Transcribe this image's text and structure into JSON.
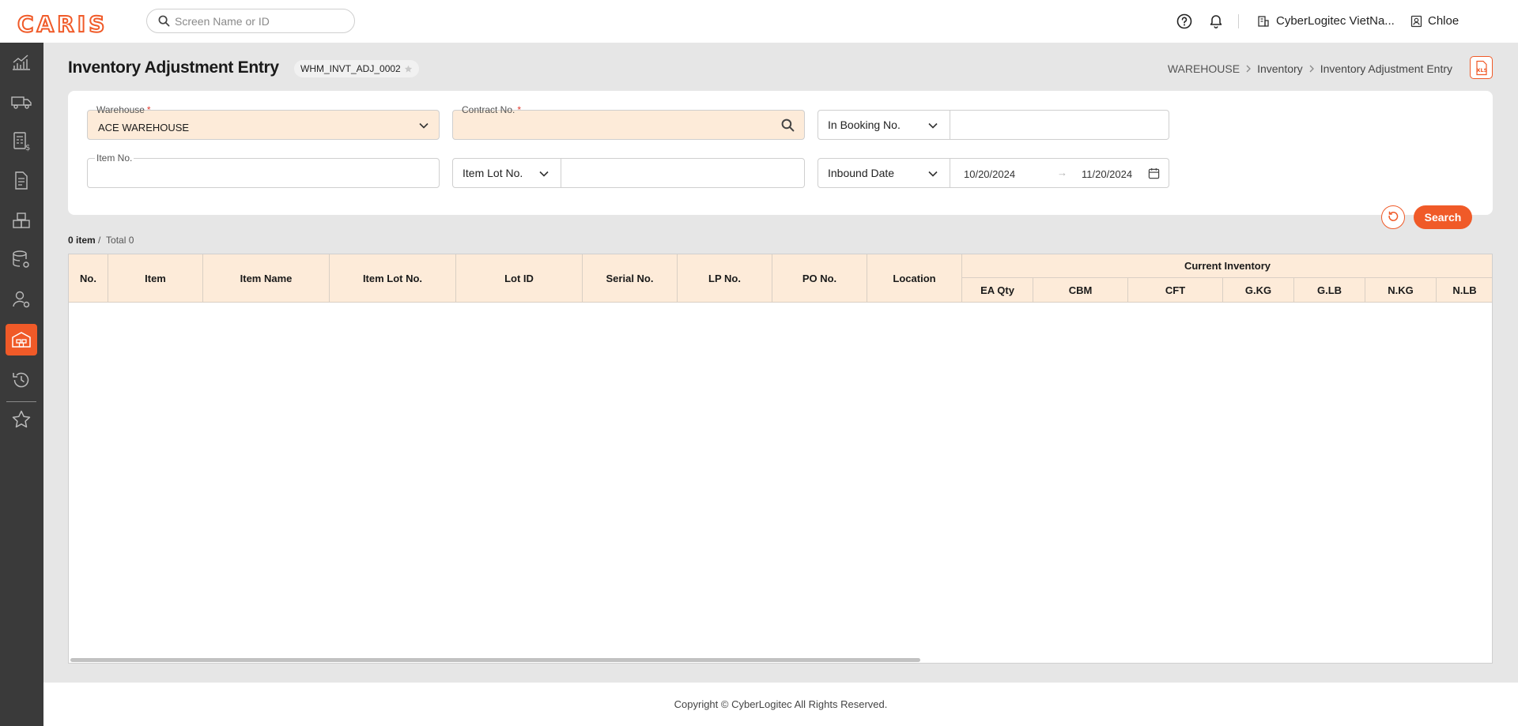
{
  "brand": {
    "logo": "CARIS",
    "accent": "#f05a28"
  },
  "header": {
    "search_placeholder": "Screen Name or ID",
    "company": "CyberLogitec VietNa...",
    "user": "Chloe"
  },
  "sidebar": {
    "items": [
      {
        "icon": "analytics-icon"
      },
      {
        "icon": "truck-icon"
      },
      {
        "icon": "billing-icon"
      },
      {
        "icon": "document-icon"
      },
      {
        "icon": "boxes-icon"
      },
      {
        "icon": "database-settings-icon"
      },
      {
        "icon": "user-settings-icon"
      },
      {
        "icon": "warehouse-icon",
        "active": true
      },
      {
        "icon": "history-icon"
      },
      {
        "icon": "star-icon"
      }
    ]
  },
  "page": {
    "title": "Inventory Adjustment Entry",
    "screen_id": "WHM_INVT_ADJ_0002",
    "breadcrumb": [
      "WAREHOUSE",
      "Inventory",
      "Inventory Adjustment Entry"
    ]
  },
  "filters": {
    "warehouse": {
      "label": "Warehouse",
      "value": "ACE WAREHOUSE"
    },
    "contract": {
      "label": "Contract No.",
      "value": ""
    },
    "booking": {
      "option": "In Booking No.",
      "value": ""
    },
    "item_no": {
      "label": "Item No.",
      "value": ""
    },
    "item_lot": {
      "option": "Item Lot No.",
      "value": ""
    },
    "inbound": {
      "option": "Inbound Date",
      "from": "10/20/2024",
      "to": "11/20/2024",
      "arrow": "→"
    },
    "search_label": "Search"
  },
  "result": {
    "items": "0 item",
    "total": "Total 0"
  },
  "grid": {
    "columns": [
      "No.",
      "Item",
      "Item Name",
      "Item Lot No.",
      "Lot ID",
      "Serial No.",
      "LP No.",
      "PO No.",
      "Location"
    ],
    "group": "Current Inventory",
    "sub_columns": [
      "EA Qty",
      "CBM",
      "CFT",
      "G.KG",
      "G.LB",
      "N.KG",
      "N.LB"
    ]
  },
  "footer": {
    "copyright": "Copyright © CyberLogitec All Rights Reserved."
  }
}
